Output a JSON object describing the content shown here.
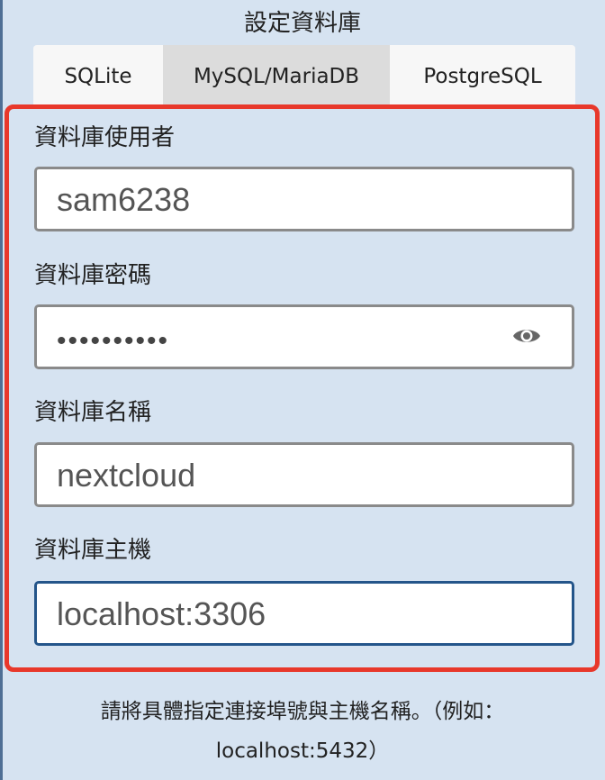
{
  "heading": "設定資料庫",
  "tabs": [
    {
      "label": "SQLite",
      "active": false
    },
    {
      "label": "MySQL/MariaDB",
      "active": true
    },
    {
      "label": "PostgreSQL",
      "active": false
    }
  ],
  "fields": {
    "user": {
      "label": "資料庫使用者",
      "value": "sam6238"
    },
    "password": {
      "label": "資料庫密碼",
      "value": "••••••••••",
      "icon": "eye-icon"
    },
    "name": {
      "label": "資料庫名稱",
      "value": "nextcloud"
    },
    "host": {
      "label": "資料庫主機",
      "value": "localhost:3306"
    }
  },
  "hint": {
    "line1": "請將具體指定連接埠號與主機名稱。（例如：",
    "line2": "localhost:5432）"
  },
  "colors": {
    "background": "#d6e3f1",
    "highlight_border": "#e8382b",
    "focus_border": "#24558a",
    "active_tab": "#dcdcdc"
  }
}
